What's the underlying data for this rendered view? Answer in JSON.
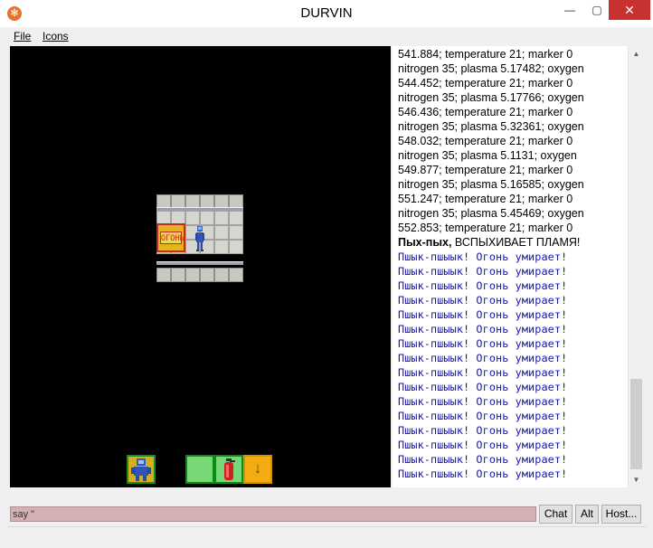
{
  "window": {
    "title": "DURVIN",
    "app_icon": "snowflake-icon"
  },
  "menu": {
    "file": "File",
    "icons": "Icons"
  },
  "map": {
    "sign_text": "ОГОНЬ",
    "hud": {
      "drop_icon": "arrow-down-icon"
    }
  },
  "chat": {
    "log_lines": [
      "541.884; temperature 21; marker 0",
      "nitrogen 35; plasma 5.17482; oxygen",
      "544.452; temperature 21; marker 0",
      "nitrogen 35; plasma 5.17766; oxygen",
      "546.436; temperature 21; marker 0",
      "nitrogen 35; plasma 5.32361; oxygen",
      "548.032; temperature 21; marker 0",
      "nitrogen 35; plasma 5.1131; oxygen",
      "549.877; temperature 21; marker 0",
      "nitrogen 35; plasma 5.16585; oxygen",
      "551.247; temperature 21; marker 0",
      "nitrogen 35; plasma 5.45469; oxygen",
      "552.853; temperature 21; marker 0"
    ],
    "alert_bold": "Пых-пых,",
    "alert_rest": " ВСПЫХИВАЕТ ПЛАМЯ!",
    "fire_line": "Пшык-пшыык! Огонь умирает!",
    "fire_count": 16,
    "colors": {
      "fire_text": "#1616b4"
    }
  },
  "input": {
    "value": "say \""
  },
  "buttons": {
    "chat": "Chat",
    "alt": "Alt",
    "host": "Host..."
  }
}
